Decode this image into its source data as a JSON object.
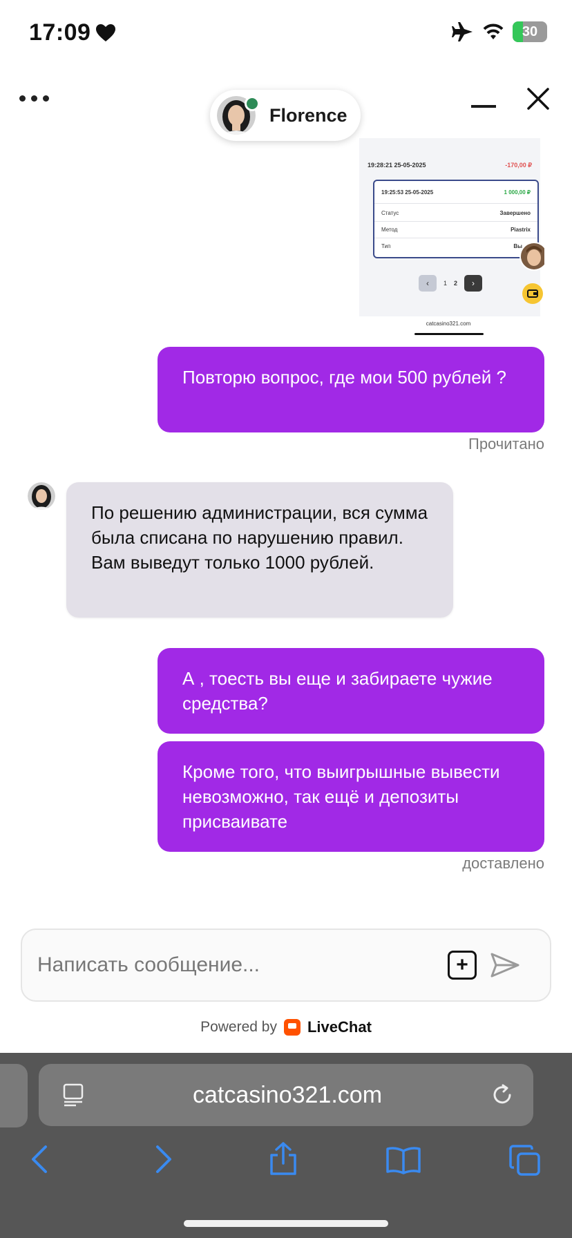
{
  "status_bar": {
    "time": "17:09",
    "battery": "30",
    "battery_level": 0.3
  },
  "header": {
    "agent_name": "Florence"
  },
  "screenshot_preview": {
    "row1_time": "19:28:21 25-05-2025",
    "row1_amount": "-170,00 ₽",
    "card_time": "19:25:53 25-05-2025",
    "card_amount": "1 000,00 ₽",
    "status_label": "Статус",
    "status_value": "Завершено",
    "method_label": "Метод",
    "method_value": "Piastrix",
    "type_label": "Тип",
    "type_value": "Вы",
    "page1": "1",
    "page2": "2",
    "url": "catcasino321.com"
  },
  "messages": [
    {
      "text": "Повторю вопрос, где мои 500 рублей ?"
    },
    {
      "text": "По решению администрации, вся сумма была списана по нарушению правил. Вам выведут только 1000 рублей."
    },
    {
      "text": "А , тоесть вы еще и забираете чужие средства?"
    },
    {
      "text": "Кроме того, что выигрышные вывести невозможно, так ещё и депозиты присваивате"
    }
  ],
  "read_status": "Прочитано",
  "delivered_status": "доставлено",
  "composer": {
    "placeholder": "Написать сообщение..."
  },
  "powered_by": "Powered by",
  "brand": "LiveChat",
  "browser": {
    "url": "catcasino321.com"
  },
  "colors": {
    "outgoing": "#a129e6",
    "incoming": "#e3e0e8",
    "safari_blue": "#3a8af0"
  }
}
